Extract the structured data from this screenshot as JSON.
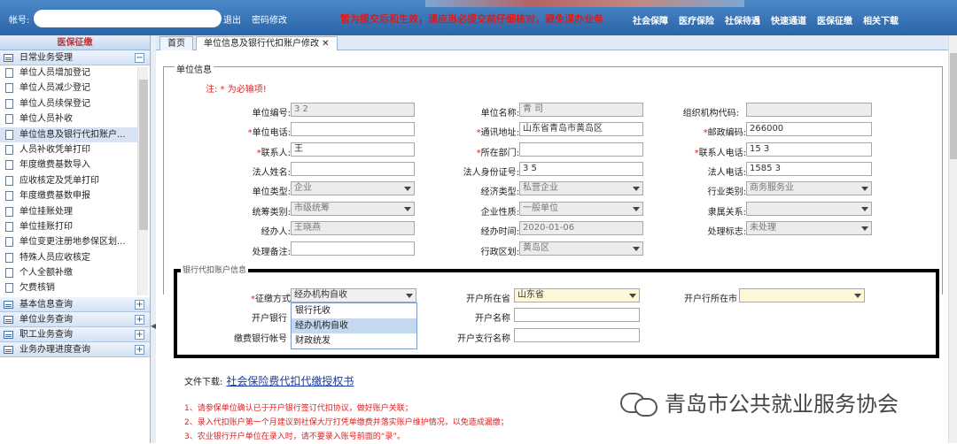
{
  "topbar": {
    "account_label": "帐号:",
    "logout": "退出",
    "change_password": "密码修改",
    "marquee": "暂为提交后和生效，请应当必提交前仔细核对，避免误办业务",
    "nav": [
      "社会保障",
      "医疗保险",
      "社保待遇",
      "快速通道",
      "医保征缴",
      "相关下载"
    ]
  },
  "sidebar": {
    "title": "医保征缴",
    "groups": {
      "daily": "日常业务受理",
      "basic": "基本信息查询",
      "unit": "单位业务查询",
      "worker": "职工业务查询",
      "progress": "业务办理进度查询"
    },
    "items": [
      "单位人员增加登记",
      "单位人员减少登记",
      "单位人员续保登记",
      "单位人员补收",
      "单位信息及银行代扣账户...",
      "人员补收凭单打印",
      "年度缴费基数导入",
      "应收核定及凭单打印",
      "年度缴费基数申报",
      "单位挂账处理",
      "单位挂账打印",
      "单位变更注册地参保区划...",
      "特殊人员应收核定",
      "个人全额补缴",
      "欠费核销"
    ]
  },
  "tabs": [
    {
      "label": "首页"
    },
    {
      "label": "单位信息及银行代扣账户修改 ✕"
    }
  ],
  "form": {
    "legend": "单位信息",
    "note": "注: * 为必输项!",
    "unit_no": {
      "label": "单位编号:",
      "value": "3                2"
    },
    "unit_name": {
      "label": "单位名称:",
      "value": "青                 司"
    },
    "org_code": {
      "label": "组织机构代码:",
      "value": ""
    },
    "unit_phone": {
      "label": "单位电话:",
      "value": ""
    },
    "address": {
      "label": "通讯地址:",
      "value": "山东省青岛市黄岛区"
    },
    "postcode": {
      "label": "邮政编码:",
      "value": "266000"
    },
    "contact": {
      "label": "联系人:",
      "value": "王"
    },
    "department": {
      "label": "所在部门:",
      "value": ""
    },
    "contact_phone": {
      "label": "联系人电话:",
      "value": "15            3"
    },
    "legal_name": {
      "label": "法人姓名:",
      "value": ""
    },
    "legal_id": {
      "label": "法人身份证号:",
      "value": "3                     5"
    },
    "legal_phone": {
      "label": "法人电话:",
      "value": "1585          3"
    },
    "unit_type": {
      "label": "单位类型:",
      "value": "企业"
    },
    "econ_type": {
      "label": "经济类型:",
      "value": "私营企业"
    },
    "industry": {
      "label": "行业类别:",
      "value": "商务服务业"
    },
    "pool_type": {
      "label": "统筹类别:",
      "value": "市级统筹"
    },
    "enterprise_nature": {
      "label": "企业性质:",
      "value": "一般单位"
    },
    "affiliation": {
      "label": "隶属关系:",
      "value": ""
    },
    "handler": {
      "label": "经办人:",
      "value": "王晓燕"
    },
    "handle_time": {
      "label": "经办时间:",
      "value": "2020-01-06"
    },
    "process_flag": {
      "label": "处理标志:",
      "value": "未处理"
    },
    "remark": {
      "label": "处理备注:",
      "value": ""
    },
    "district": {
      "label": "行政区划:",
      "value": "黄岛区"
    }
  },
  "bank": {
    "legend": "银行代扣账户信息",
    "collect_method": {
      "label": "征缴方式",
      "value": "经办机构自收",
      "options": [
        "银行托收",
        "经办机构自收",
        "财政统发"
      ]
    },
    "bank_name_label": "开户银行",
    "pay_account_label": "缴费银行帐号",
    "province": {
      "label": "开户所在省",
      "value": "山东省"
    },
    "account_name_label": "开户名称",
    "branch_label": "开户支行名称",
    "city": {
      "label": "开户行所在市",
      "value": ""
    }
  },
  "download": {
    "label": "文件下载:",
    "link": "社会保险费代扣代缴授权书"
  },
  "tips": [
    "1、请参保单位确认已于开户银行签订代扣协议，做好账户关联；",
    "2、录入代扣账户第一个月建议到社保大厅打凭单缴费并落实账户维护情况，以免造成漏缴；",
    "3、农业银行开户单位在录入时，请不要录入账号前面的“录”。"
  ],
  "watermark": "青岛市公共就业服务协会"
}
